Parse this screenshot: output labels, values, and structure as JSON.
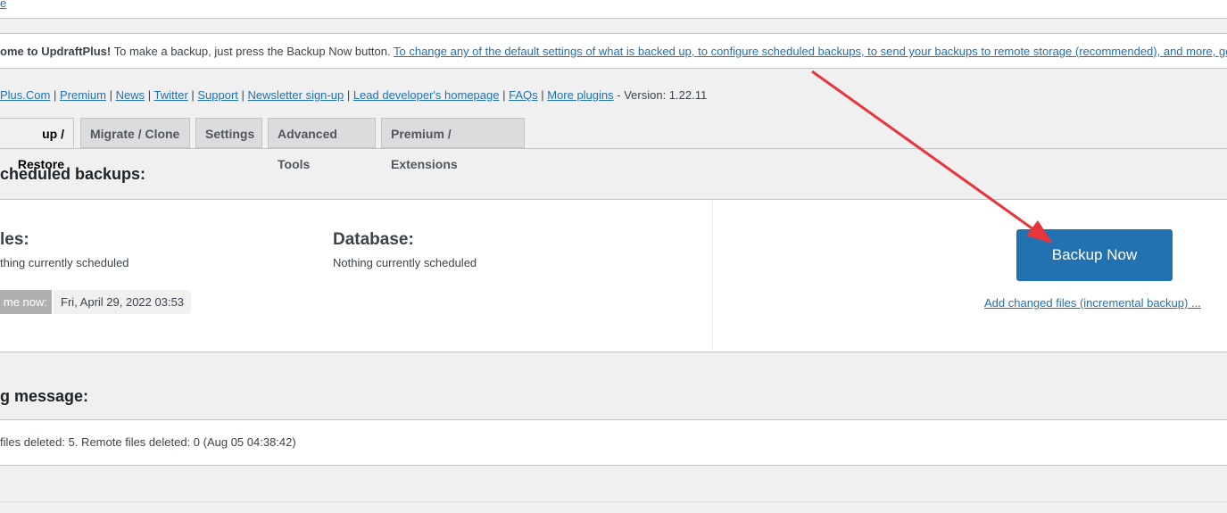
{
  "top_link": "e",
  "notice": {
    "welcome_bold": "ome to UpdraftPlus!",
    "welcome_text": " To make a backup, just press the Backup Now button. ",
    "settings_link": "To change any of the default settings of what is backed up, to configure scheduled backups, to send your backups to remote storage (recommended), and more, go to"
  },
  "links": [
    "Plus.Com",
    "Premium",
    "News",
    "Twitter",
    "Support",
    "Newsletter sign-up",
    "Lead developer's homepage",
    "FAQs",
    "More plugins"
  ],
  "version": " - Version: 1.22.11",
  "tabs": [
    "up / Restore",
    "Migrate / Clone",
    "Settings",
    "Advanced Tools",
    "Premium / Extensions"
  ],
  "scheduled": {
    "heading": "cheduled backups:",
    "files_label": "les:",
    "files_status": "thing currently scheduled",
    "db_label": "Database:",
    "db_status": "Nothing currently scheduled",
    "time_label": "me now:",
    "time_value": "Fri, April 29, 2022 03:53"
  },
  "backup_button": "Backup Now",
  "incremental_link": "Add changed files (incremental backup) ...",
  "log": {
    "heading": "g message:",
    "text": " files deleted: 5. Remote files deleted: 0 (Aug 05 04:38:42)"
  },
  "colors": {
    "accent": "#2271b1",
    "arrow": "#e8343a"
  }
}
